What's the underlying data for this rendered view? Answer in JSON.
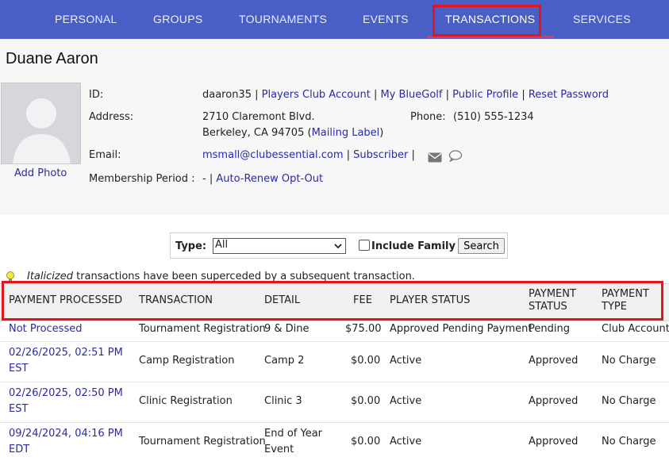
{
  "nav": {
    "tabs": [
      "PERSONAL",
      "GROUPS",
      "TOURNAMENTS",
      "EVENTS",
      "TRANSACTIONS",
      "SERVICES"
    ],
    "active": "TRANSACTIONS"
  },
  "profile": {
    "name": "Duane Aaron",
    "add_photo": "Add Photo",
    "id_label": "ID:",
    "id_value": "daaron35",
    "id_links": [
      "Players Club Account",
      "My BlueGolf",
      "Public Profile",
      "Reset Password"
    ],
    "address_label": "Address:",
    "address_line1": "2710 Claremont Blvd.",
    "address_line2": "Berkeley, CA 94705",
    "mailing_label": "Mailing Label",
    "phone_label": "Phone:",
    "phone_value": "(510) 555-1234",
    "email_label": "Email:",
    "email_value": "msmall@clubessential.com",
    "subscriber": "Subscriber",
    "membership_label": "Membership Period :",
    "membership_value": "-",
    "auto_renew": "Auto-Renew Opt-Out"
  },
  "filter": {
    "type_label": "Type:",
    "type_value": "All",
    "include_family": "Include Family",
    "search_button": "Search"
  },
  "note": {
    "italic": "Italicized",
    "rest": "transactions have been superceded by a subsequent transaction."
  },
  "table": {
    "headers": {
      "processed": "PAYMENT PROCESSED",
      "transaction": "TRANSACTION",
      "detail": "DETAIL",
      "fee": "FEE",
      "player_status": "PLAYER STATUS",
      "payment_status_1": "PAYMENT",
      "payment_status_2": "STATUS",
      "payment_type_1": "PAYMENT",
      "payment_type_2": "TYPE"
    },
    "rows": [
      {
        "processed_1": "Not Processed",
        "processed_2": "",
        "transaction": "Tournament Registration",
        "detail_1": "9 & Dine",
        "detail_2": "",
        "fee": "$75.00",
        "player_status": "Approved Pending Payment",
        "payment_status": "Pending",
        "payment_type": "Club Account"
      },
      {
        "processed_1": "02/26/2025, 02:51 PM",
        "processed_2": "EST",
        "transaction": "Camp Registration",
        "detail_1": "Camp 2",
        "detail_2": "",
        "fee": "$0.00",
        "player_status": "Active",
        "payment_status": "Approved",
        "payment_type": "No Charge"
      },
      {
        "processed_1": "02/26/2025, 02:50 PM",
        "processed_2": "EST",
        "transaction": "Clinic Registration",
        "detail_1": "Clinic 3",
        "detail_2": "",
        "fee": "$0.00",
        "player_status": "Active",
        "payment_status": "Approved",
        "payment_type": "No Charge"
      },
      {
        "processed_1": "09/24/2024, 04:16 PM",
        "processed_2": "EDT",
        "transaction": "Tournament Registration",
        "detail_1": "End of Year",
        "detail_2": "Event",
        "fee": "$0.00",
        "player_status": "Active",
        "payment_status": "Approved",
        "payment_type": "No Charge"
      }
    ]
  },
  "colors": {
    "nav_bg": "#4a5fc6",
    "highlight": "#e3141b",
    "link": "#2a2aa6"
  }
}
